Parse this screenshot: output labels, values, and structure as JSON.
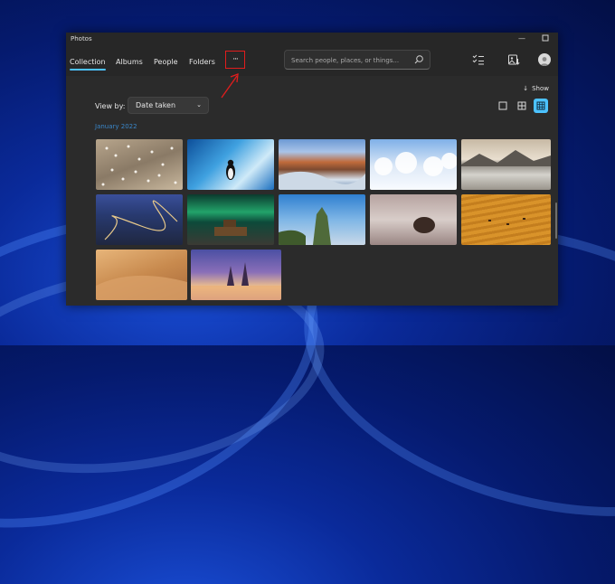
{
  "window": {
    "title": "Photos"
  },
  "nav": {
    "tabs": [
      {
        "label": "Collection",
        "active": true
      },
      {
        "label": "Albums"
      },
      {
        "label": "People"
      },
      {
        "label": "Folders"
      }
    ],
    "more_label": "···",
    "search_placeholder": "Search people, places, or things..."
  },
  "toolbar": {
    "show_label": "Show",
    "view_by_label": "View by:",
    "view_by_value": "Date taken"
  },
  "gallery": {
    "group_title": "January 2022",
    "photos": [
      "birds-flock",
      "ice-cave-penguin",
      "glacier-canyon",
      "snowy-forest",
      "mountain-lake-reflection",
      "winding-road-mountains",
      "aurora-ship",
      "rock-pillar-fog",
      "porcupine-snow",
      "orange-field-deer",
      "desert-dunes",
      "city-night-cathedral"
    ]
  },
  "colors": {
    "accent": "#4cc2ff",
    "highlight_box": "#e21d1d",
    "group_title": "#3a86c8"
  },
  "icons": [
    "search-icon",
    "select-icon",
    "import-icon",
    "sort-arrow-icon",
    "single-layout-icon",
    "grid-layout-icon",
    "tiles-layout-icon",
    "chevron-down-icon",
    "minimize-icon",
    "maximize-icon"
  ]
}
